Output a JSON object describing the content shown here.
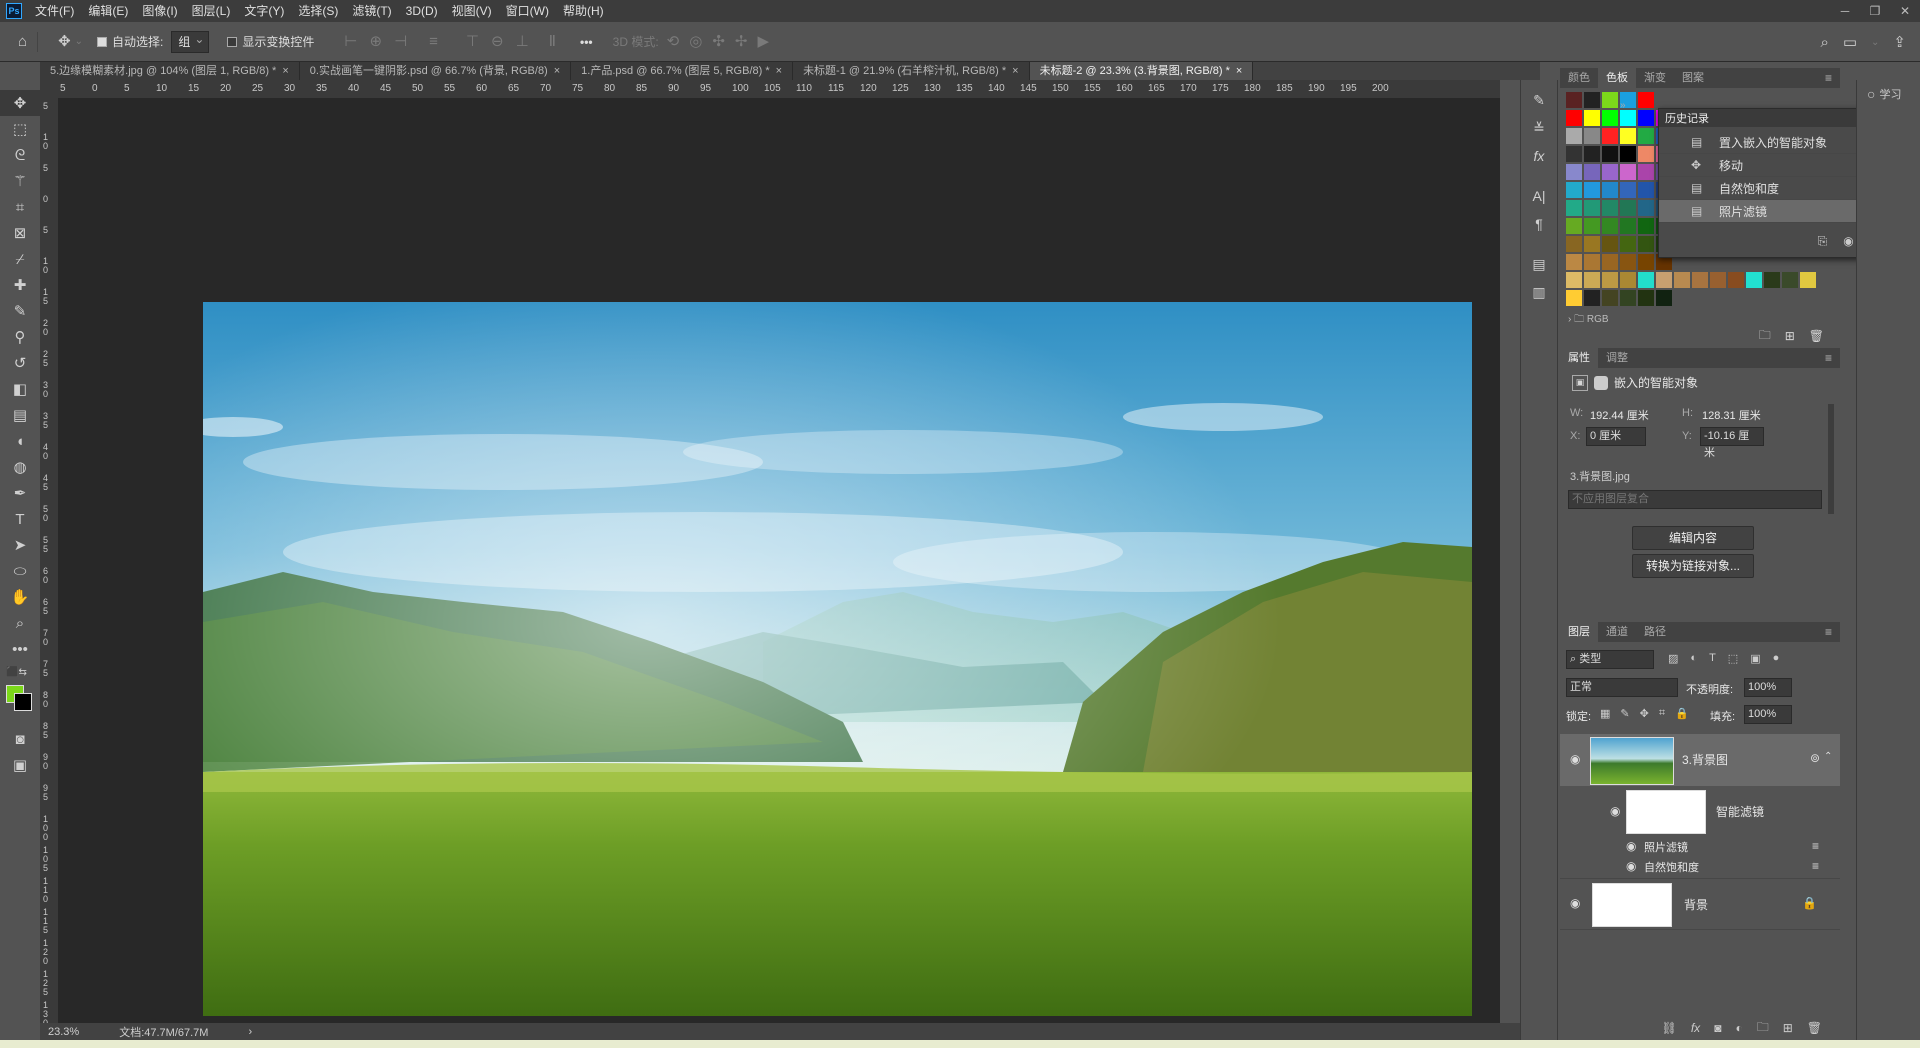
{
  "menu": [
    "文件(F)",
    "编辑(E)",
    "图像(I)",
    "图层(L)",
    "文字(Y)",
    "选择(S)",
    "滤镜(T)",
    "3D(D)",
    "视图(V)",
    "窗口(W)",
    "帮助(H)"
  ],
  "app_logo": "Ps",
  "options": {
    "auto_select_label": "自动选择:",
    "auto_select_value": "组",
    "show_transform_label": "显示变换控件",
    "more": "•••",
    "mode_3d_label": "3D 模式:"
  },
  "tabs": [
    "5.边缘模糊素材.jpg @ 104% (图层 1, RGB/8) *",
    "0.实战画笔一键阴影.psd @ 66.7% (背景, RGB/8)",
    "1.产品.psd @ 66.7% (图层 5, RGB/8) *",
    "未标题-1 @ 21.9% (石羊榨汁机, RGB/8) *",
    "未标题-2 @ 23.3% (3.背景图, RGB/8) *"
  ],
  "tab_close": "×",
  "ruler_top_labels": [
    "5",
    "0",
    "5",
    "10",
    "15",
    "20",
    "25",
    "30",
    "35",
    "40",
    "45",
    "50",
    "55",
    "60",
    "65",
    "70",
    "75",
    "80",
    "85",
    "90",
    "95",
    "100",
    "105",
    "110",
    "115",
    "120",
    "125",
    "130",
    "135",
    "140",
    "145",
    "150",
    "155",
    "160",
    "165",
    "170",
    "175",
    "180",
    "185",
    "190",
    "195",
    "200"
  ],
  "ruler_left_labels": [
    "5",
    "1 0",
    "5",
    "0",
    "5",
    "1 0",
    "1 5",
    "2 0",
    "2 5",
    "3 0",
    "3 5",
    "4 0",
    "4 5",
    "5 0",
    "5 5",
    "6 0",
    "6 5",
    "7 0",
    "7 5",
    "8 0",
    "8 5",
    "9 0",
    "9 5",
    "1 0 0",
    "1 0 5",
    "1 1 0",
    "1 1 5",
    "1 2 0",
    "1 2 5",
    "1 3 0"
  ],
  "status": {
    "zoom": "23.3%",
    "doc": "文档:47.7M/67.7M",
    "arrow": "›"
  },
  "swatches_panel": {
    "tabs": [
      "颜色",
      "色板",
      "渐变",
      "图案"
    ],
    "active": "色板",
    "group_label": "RGB",
    "rows": [
      [
        "#5a2222",
        "#222222",
        "#7cd81a",
        "#1aa0e0",
        "#ff0000"
      ],
      [
        "#ff0000",
        "#ffff00",
        "#00ff00",
        "#00ffff",
        "#0000ff",
        "#ff00ff"
      ],
      [
        "#aaaaaa",
        "#888888",
        "#ff2222",
        "#ffff22",
        "#22aa44",
        "#2266cc"
      ],
      [
        "#333333",
        "#222222",
        "#111111",
        "#000000",
        "#ee8866",
        "#ee66aa"
      ],
      [
        "#8888cc",
        "#7766bb",
        "#9966cc",
        "#cc66cc",
        "#aa44aa",
        "#7755aa"
      ],
      [
        "#22aacc",
        "#2299dd",
        "#2288cc",
        "#3366bb",
        "#2255aa",
        "#224488"
      ],
      [
        "#22aa88",
        "#229977",
        "#228866",
        "#227755",
        "#226688",
        "#225577"
      ],
      [
        "#66aa22",
        "#449922",
        "#338822",
        "#227722",
        "#116611",
        "#115511"
      ],
      [
        "#886622",
        "#997722",
        "#665511",
        "#446611",
        "#335511",
        "#224411"
      ],
      [
        "#bb8844",
        "#aa7733",
        "#996622",
        "#885511",
        "#774400",
        "#663300"
      ],
      [
        "#ddbb66",
        "#ccaa55",
        "#bb9944",
        "#aa8833",
        "#22ddcc",
        "#eedd55"
      ],
      [
        "#ffcc33",
        "#222222",
        "#444422",
        "#334422",
        "#223311",
        "#112211"
      ]
    ],
    "extra_row": [
      "#c8a070",
      "#b88a50",
      "#a87440",
      "#986030",
      "#884c20",
      "#22e0d0",
      "#2a3a1a",
      "#3a4a2a",
      "#e0c840"
    ]
  },
  "history_panel": {
    "title": "历史记录",
    "items": [
      {
        "icon": "document-icon",
        "label": "置入嵌入的智能对象"
      },
      {
        "icon": "move-icon",
        "label": "移动"
      },
      {
        "icon": "document-icon",
        "label": "自然饱和度"
      },
      {
        "icon": "document-icon",
        "label": "照片滤镜"
      }
    ]
  },
  "properties_panel": {
    "tabs": [
      "属性",
      "调整"
    ],
    "active": "属性",
    "type_label": "嵌入的智能对象",
    "w_label": "W:",
    "w_value": "192.44 厘米",
    "h_label": "H:",
    "h_value": "128.31 厘米",
    "x_label": "X:",
    "x_value": "0 厘米",
    "y_label": "Y:",
    "y_value": "-10.16 厘米",
    "filename": "3.背景图.jpg",
    "comp_placeholder": "不应用图层复合",
    "edit_button": "编辑内容",
    "convert_button": "转换为链接对象..."
  },
  "layers_panel": {
    "tabs": [
      "图层",
      "通道",
      "路径"
    ],
    "active": "图层",
    "filter_label": "类型",
    "blend_mode": "正常",
    "opacity_label": "不透明度:",
    "opacity_value": "100%",
    "lock_label": "锁定:",
    "fill_label": "填充:",
    "fill_value": "100%",
    "layers": [
      {
        "name": "3.背景图",
        "type": "smart-object"
      },
      {
        "name": "智能滤镜",
        "type": "filter-mask"
      },
      {
        "name": "照片滤镜",
        "type": "filter"
      },
      {
        "name": "自然饱和度",
        "type": "filter"
      },
      {
        "name": "背景",
        "type": "background"
      }
    ]
  },
  "far_right_label": "学习",
  "colors": {
    "foreground": "#7cd81a",
    "background": "#000000",
    "ps_blue": "#31a8ff"
  }
}
